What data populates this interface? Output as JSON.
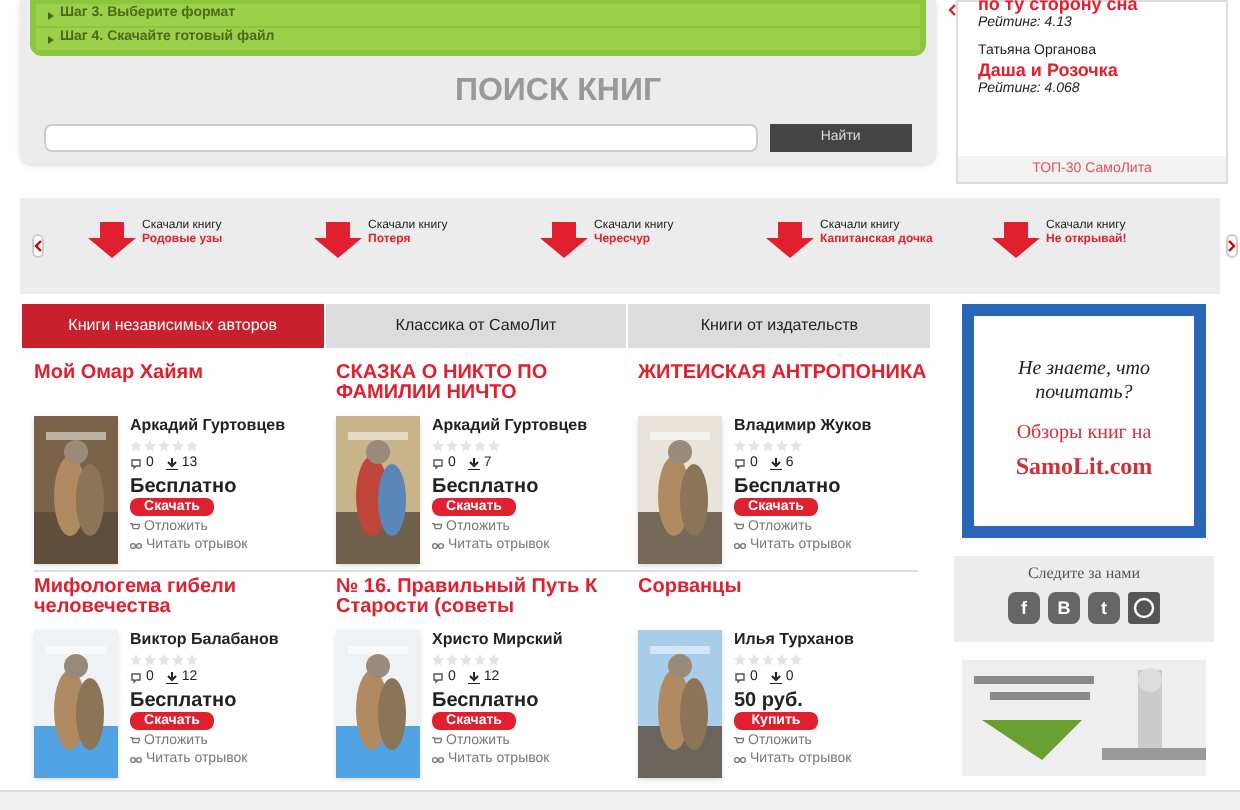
{
  "steps": [
    "Шаг 3. Выберите формат",
    "Шаг 4. Скачайте готовый файл"
  ],
  "search": {
    "title": "ПОИСК КНИГ",
    "button": "Найти"
  },
  "top": {
    "items": [
      {
        "title": "по ту сторону сна",
        "rating": "Рейтинг: 4.13"
      },
      {
        "author": "Татьяна Органова",
        "title": "Даша и Розочка",
        "rating": "Рейтинг: 4.068"
      }
    ],
    "footer": "ТОП-30 СамоЛита"
  },
  "downloads": [
    {
      "label": "Скачали книгу",
      "title": "Родовые узы"
    },
    {
      "label": "Скачали книгу",
      "title": "Потеря"
    },
    {
      "label": "Скачали книгу",
      "title": "Чересчур"
    },
    {
      "label": "Скачали книгу",
      "title": "Капитанская дочка"
    },
    {
      "label": "Скачали книгу",
      "title": "Не открывай!"
    }
  ],
  "tabs": [
    {
      "label": "Книги независимых авторов",
      "selected": true
    },
    {
      "label": "Классика от СамоЛит",
      "selected": false
    },
    {
      "label": "Книги от издательств",
      "selected": false
    }
  ],
  "books": [
    {
      "title": "Мой Омар Хайям",
      "author": "Аркадий Гуртовцев",
      "stars": 0,
      "comments": "0",
      "downloads": "13",
      "price": "Бесплатно",
      "button": "Скачать",
      "defer": "Отложить",
      "read": "Читать отрывок"
    },
    {
      "title": "СКАЗКА О НИКТО ПО ФАМИЛИИ НИЧТО",
      "author": "Аркадий Гуртовцев",
      "stars": 0,
      "comments": "0",
      "downloads": "7",
      "price": "Бесплатно",
      "button": "Скачать",
      "defer": "Отложить",
      "read": "Читать отрывок"
    },
    {
      "title": "ЖИТЕИСКАЯ АНТРОПОНИКА",
      "author": "Владимир Жуков",
      "stars": 0,
      "comments": "0",
      "downloads": "6",
      "price": "Бесплатно",
      "button": "Скачать",
      "defer": "Отложить",
      "read": "Читать отрывок"
    },
    {
      "title": "Мифологема гибели человечества",
      "author": "Виктор Балабанов",
      "stars": 0,
      "comments": "0",
      "downloads": "12",
      "price": "Бесплатно",
      "button": "Скачать",
      "defer": "Отложить",
      "read": "Читать отрывок"
    },
    {
      "title": "№ 16. Правильный Путь К Старости (советы",
      "author": "Христо Мирский",
      "stars": 0,
      "comments": "0",
      "downloads": "12",
      "price": "Бесплатно",
      "button": "Скачать",
      "defer": "Отложить",
      "read": "Читать отрывок"
    },
    {
      "title": "Сорванцы",
      "author": "Илья Турханов",
      "stars": 0,
      "comments": "0",
      "downloads": "0",
      "price": "50 руб.",
      "button": "Купить",
      "defer": "Отложить",
      "read": "Читать отрывок"
    }
  ],
  "promo": {
    "question": "Не знаете, что почитать?",
    "offer": "Обзоры книг на",
    "site": "SamoLit.com"
  },
  "social": {
    "title": "Следите за нами",
    "icons": [
      "f",
      "B",
      "t"
    ]
  }
}
